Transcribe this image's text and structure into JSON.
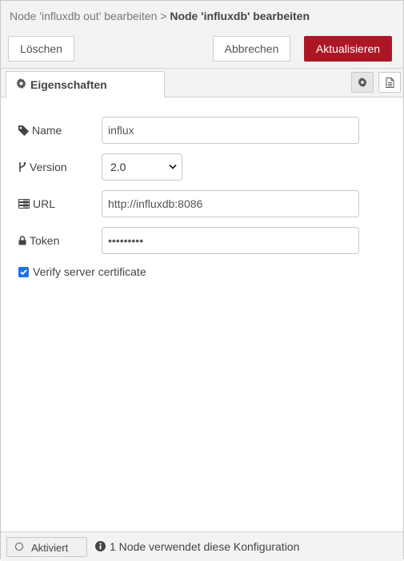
{
  "header": {
    "breadcrumb_parent": "Node 'influxdb out' bearbeiten",
    "separator": ">",
    "breadcrumb_current": "Node 'influxdb' bearbeiten"
  },
  "toolbar": {
    "delete_label": "Löschen",
    "cancel_label": "Abbrechen",
    "update_label": "Aktualisieren"
  },
  "tabs": {
    "properties_label": "Eigenschaften"
  },
  "form": {
    "name_label": "Name",
    "name_value": "influx",
    "version_label": "Version",
    "version_value": "2.0",
    "url_label": "URL",
    "url_value": "http://influxdb:8086",
    "token_label": "Token",
    "token_value": "•••••••••",
    "verify_label": "Verify server certificate",
    "verify_checked": true
  },
  "footer": {
    "toggle_label": "Aktiviert",
    "usage_text": "1 Node verwendet diese Konfiguration"
  },
  "colors": {
    "accent": "#ad1625",
    "checkbox": "#1a73e8",
    "panel_bg": "#f3f3f3"
  },
  "icons": {
    "tab": "gear-icon",
    "settings_button": "gear-icon",
    "doc_button": "document-icon",
    "name": "tag-icon",
    "version": "branch-icon",
    "url": "server-icon",
    "token": "lock-icon",
    "usage": "info-icon",
    "toggle": "circle-icon"
  }
}
